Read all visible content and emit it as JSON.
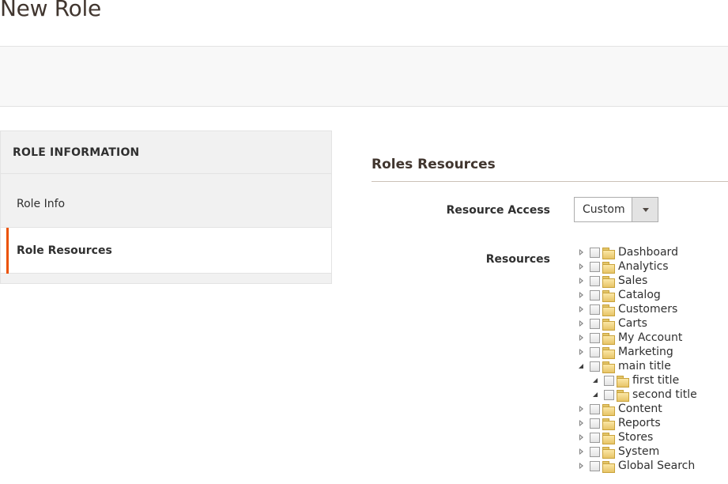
{
  "page": {
    "title": "New Role"
  },
  "tabs": {
    "title": "ROLE INFORMATION",
    "items": [
      {
        "label": "Role Info",
        "active": false
      },
      {
        "label": "Role Resources",
        "active": true
      }
    ]
  },
  "section": {
    "title": "Roles Resources",
    "resource_access_label": "Resource Access",
    "resource_access_value": "Custom",
    "resources_label": "Resources"
  },
  "tree": [
    {
      "label": "Dashboard",
      "state": "closed",
      "level": 0
    },
    {
      "label": "Analytics",
      "state": "closed",
      "level": 0
    },
    {
      "label": "Sales",
      "state": "closed",
      "level": 0
    },
    {
      "label": "Catalog",
      "state": "closed",
      "level": 0
    },
    {
      "label": "Customers",
      "state": "closed",
      "level": 0
    },
    {
      "label": "Carts",
      "state": "closed",
      "level": 0
    },
    {
      "label": "My Account",
      "state": "closed",
      "level": 0
    },
    {
      "label": "Marketing",
      "state": "closed",
      "level": 0
    },
    {
      "label": "main title",
      "state": "open",
      "level": 0
    },
    {
      "label": "first title",
      "state": "open",
      "level": 1
    },
    {
      "label": "second title",
      "state": "open",
      "level": 1
    },
    {
      "label": "Content",
      "state": "closed",
      "level": 0
    },
    {
      "label": "Reports",
      "state": "closed",
      "level": 0
    },
    {
      "label": "Stores",
      "state": "closed",
      "level": 0
    },
    {
      "label": "System",
      "state": "closed",
      "level": 0
    },
    {
      "label": "Global Search",
      "state": "closed",
      "level": 0
    }
  ],
  "colors": {
    "accent": "#eb5202",
    "title": "#41362f"
  }
}
